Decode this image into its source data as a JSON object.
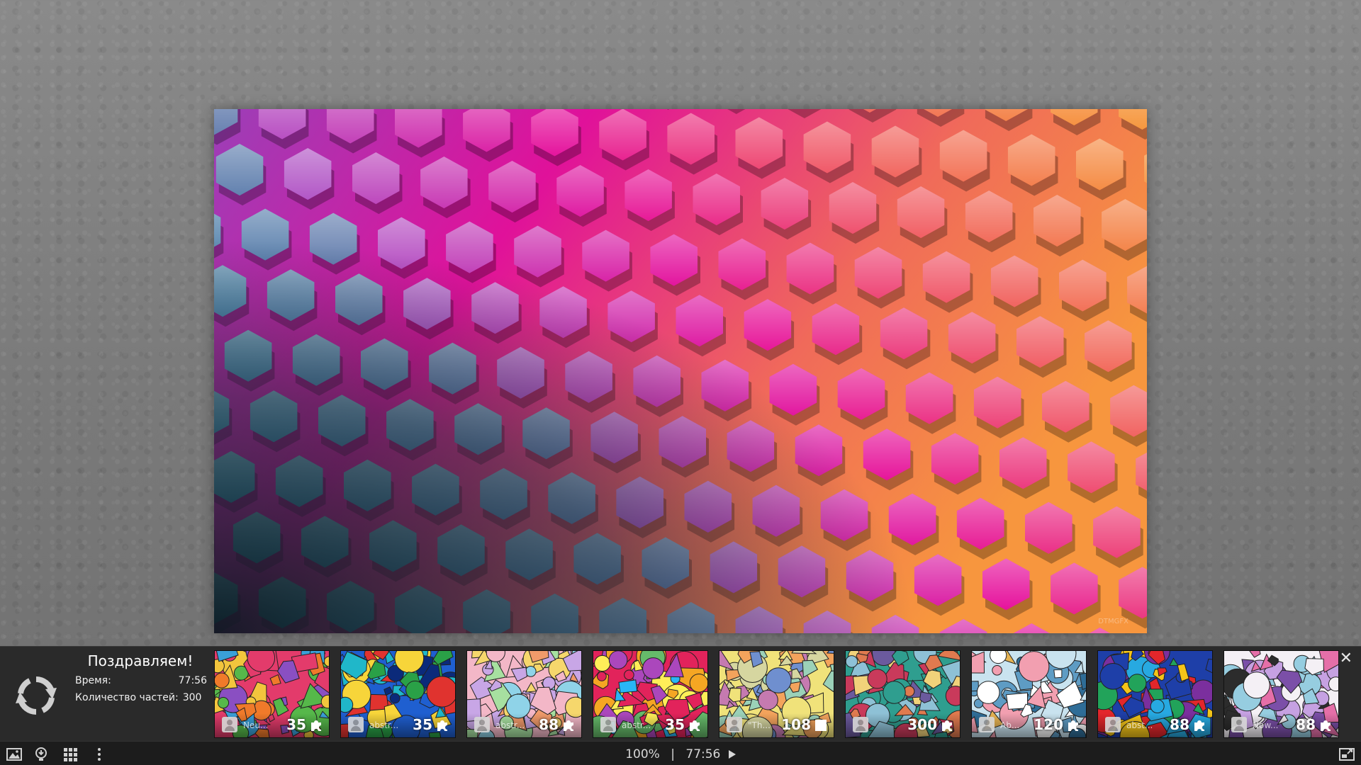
{
  "result_panel": {
    "title": "Поздравляем!",
    "time_label": "Время:",
    "time_value": "77:56",
    "pieces_label": "Количество частей:",
    "pieces_value": "300",
    "close_label": "✕"
  },
  "thumbnails": [
    {
      "title": "Neu...",
      "pieces": "35",
      "icon": "puzzle-piece-icon"
    },
    {
      "title": "abstr...",
      "pieces": "35",
      "icon": "puzzle-piece-icon"
    },
    {
      "title": "abstr...",
      "pieces": "88",
      "icon": "puzzle-piece-icon"
    },
    {
      "title": "abstr...",
      "pieces": "35",
      "icon": "puzzle-piece-icon"
    },
    {
      "title": "\"Th...",
      "pieces": "108",
      "icon": "square-piece-icon"
    },
    {
      "title": "",
      "pieces": "300",
      "icon": "puzzle-piece-icon"
    },
    {
      "title": "Ab...",
      "pieces": "120",
      "icon": "puzzle-piece-icon"
    },
    {
      "title": "abst...",
      "pieces": "88",
      "icon": "puzzle-piece-icon"
    },
    {
      "title": "Now...",
      "pieces": "88",
      "icon": "puzzle-piece-icon"
    }
  ],
  "toolbar": {
    "zoom": "100%",
    "separator": "|",
    "timer": "77:56",
    "left_icons": [
      "image-icon",
      "hint-icon",
      "grid-icon",
      "more-menu-icon"
    ],
    "right_icon": "fullscreen-icon"
  },
  "image_watermark": "DTMGFX",
  "colors": {
    "panel_bg": "#2a2a2a",
    "toolbar_bg": "#1c1c1c",
    "page_bg": "#7b7b7b"
  }
}
